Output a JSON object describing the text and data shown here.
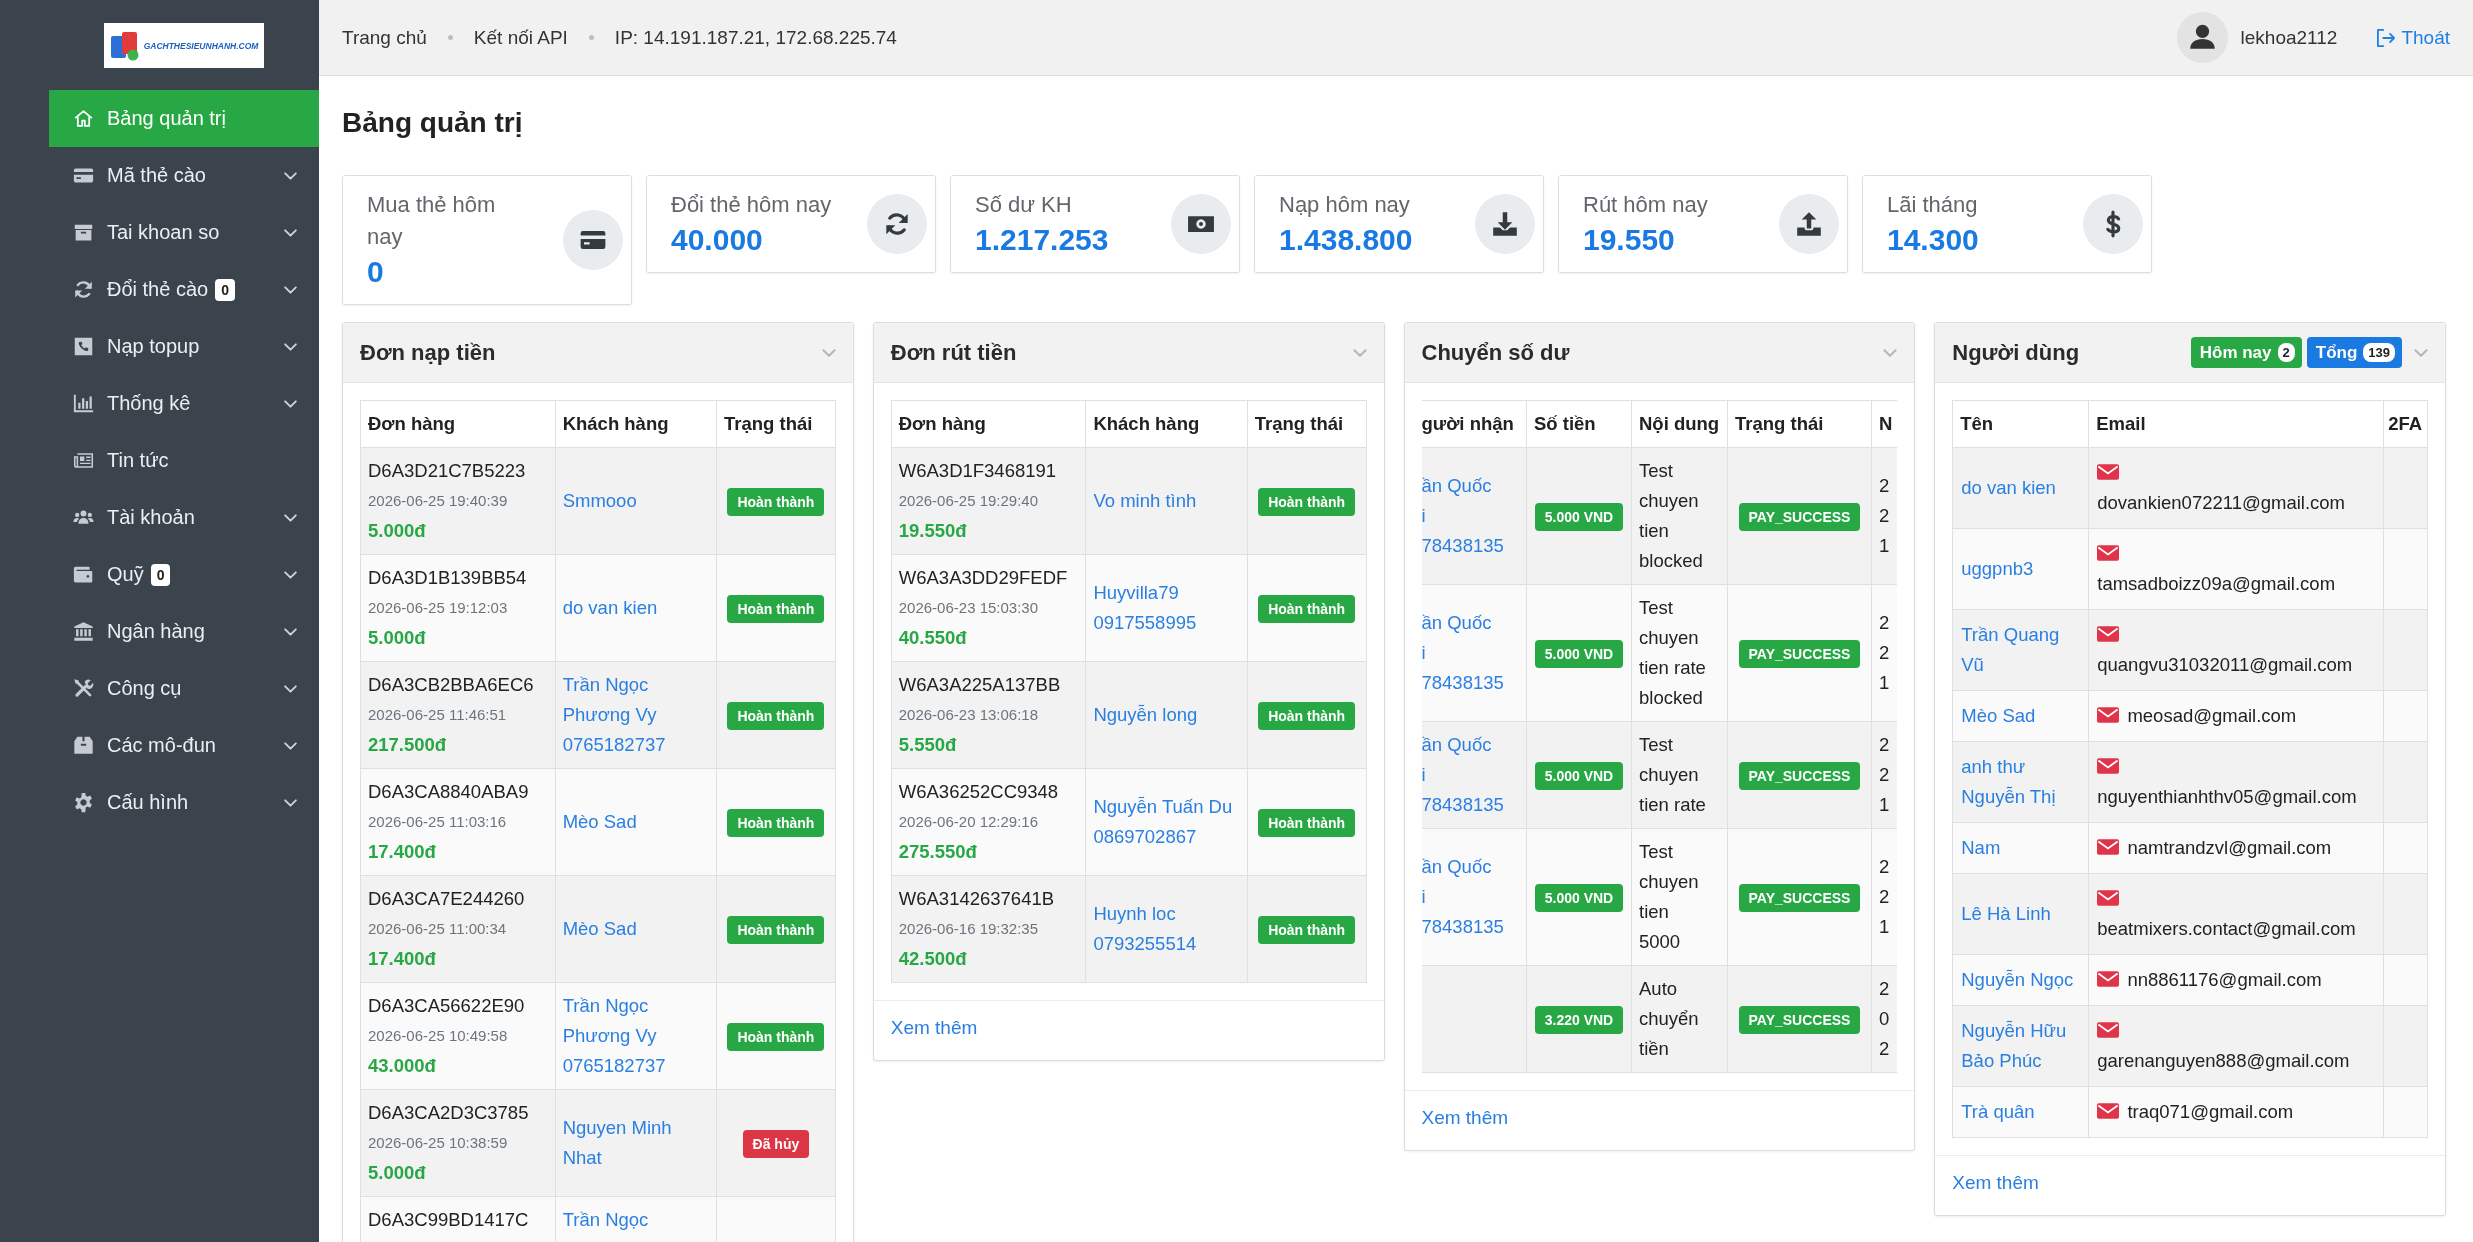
{
  "sidebar": {
    "logo": {
      "text": "GACHTHESIEUNHANH.COM"
    },
    "items": [
      {
        "label": "Bảng quản trị",
        "selected": true,
        "has_submenu": false
      },
      {
        "label": "Mã thẻ cào",
        "selected": false,
        "has_submenu": true
      },
      {
        "label": "Tai khoan so",
        "selected": false,
        "has_submenu": true
      },
      {
        "label": "Đổi thẻ cào",
        "badge": "0",
        "selected": false,
        "has_submenu": true
      },
      {
        "label": "Nạp topup",
        "selected": false,
        "has_submenu": true
      },
      {
        "label": "Thống kê",
        "selected": false,
        "has_submenu": true
      },
      {
        "label": "Tin tức",
        "selected": false,
        "has_submenu": false
      },
      {
        "label": "Tài khoản",
        "selected": false,
        "has_submenu": true
      },
      {
        "label": "Quỹ",
        "badge": "0",
        "selected": false,
        "has_submenu": true
      },
      {
        "label": "Ngân hàng",
        "selected": false,
        "has_submenu": true
      },
      {
        "label": "Công cụ",
        "selected": false,
        "has_submenu": true
      },
      {
        "label": "Các mô-đun",
        "selected": false,
        "has_submenu": true
      },
      {
        "label": "Cấu hình",
        "selected": false,
        "has_submenu": true
      }
    ]
  },
  "header": {
    "nav_links": [
      "Trang chủ",
      "Kết nối API"
    ],
    "ip_text": "IP: 14.191.187.21, 172.68.225.74",
    "username": "lekhoa2112",
    "logout": "Thoát"
  },
  "page_title": "Bảng quản trị",
  "stats": [
    {
      "label": "Mua thẻ hôm nay",
      "value": "0"
    },
    {
      "label": "Đổi thẻ hôm nay",
      "value": "40.000"
    },
    {
      "label": "Số dư KH",
      "value": "1.217.253"
    },
    {
      "label": "Nạp hôm nay",
      "value": "1.438.800"
    },
    {
      "label": "Rút hôm nay",
      "value": "19.550"
    },
    {
      "label": "Lãi tháng",
      "value": "14.300"
    }
  ],
  "panels": [
    {
      "kind": "orders",
      "title": "Đơn nạp tiền",
      "table": {
        "columns": [
          "Đơn hàng",
          "Khách hàng",
          "Trạng thái"
        ],
        "rows": [
          {
            "order_id": "D6A3D21C7B5223",
            "time": "2026-06-25 19:40:39",
            "amount": "5.000đ",
            "customer": {
              "name": "Smmooo"
            },
            "status": {
              "label": "Hoàn thành",
              "kind": "success"
            }
          },
          {
            "order_id": "D6A3D1B139BB54",
            "time": "2026-06-25 19:12:03",
            "amount": "5.000đ",
            "customer": {
              "name": "do van kien"
            },
            "status": {
              "label": "Hoàn thành",
              "kind": "success"
            }
          },
          {
            "order_id": "D6A3CB2BBA6EC6",
            "time": "2026-06-25 11:46:51",
            "amount": "217.500đ",
            "customer": {
              "name": "Trần Ngọc Phương Vy",
              "phone": "0765182737"
            },
            "status": {
              "label": "Hoàn thành",
              "kind": "success"
            }
          },
          {
            "order_id": "D6A3CA8840ABA9",
            "time": "2026-06-25 11:03:16",
            "amount": "17.400đ",
            "customer": {
              "name": "Mèo Sad"
            },
            "status": {
              "label": "Hoàn thành",
              "kind": "success"
            }
          },
          {
            "order_id": "D6A3CA7E244260",
            "time": "2026-06-25 11:00:34",
            "amount": "17.400đ",
            "customer": {
              "name": "Mèo Sad"
            },
            "status": {
              "label": "Hoàn thành",
              "kind": "success"
            }
          },
          {
            "order_id": "D6A3CA56622E90",
            "time": "2026-06-25 10:49:58",
            "amount": "43.000đ",
            "customer": {
              "name": "Trần Ngọc Phương Vy",
              "phone": "0765182737"
            },
            "status": {
              "label": "Hoàn thành",
              "kind": "success"
            }
          },
          {
            "order_id": "D6A3CA2D3C3785",
            "time": "2026-06-25 10:38:59",
            "amount": "5.000đ",
            "customer": {
              "name": "Nguyen Minh Nhat"
            },
            "status": {
              "label": "Đã hủy",
              "kind": "cancelled"
            }
          },
          {
            "order_id": "D6A3C99BD1417C",
            "customer": {
              "name": "Trần Ngọc"
            }
          }
        ]
      }
    },
    {
      "kind": "orders",
      "title": "Đơn rút tiền",
      "table": {
        "columns": [
          "Đơn hàng",
          "Khách hàng",
          "Trạng thái"
        ],
        "rows": [
          {
            "order_id": "W6A3D1F3468191",
            "time": "2026-06-25 19:29:40",
            "amount": "19.550đ",
            "customer": {
              "name": "Vo minh tình"
            },
            "status": {
              "label": "Hoàn thành",
              "kind": "success"
            }
          },
          {
            "order_id": "W6A3A3DD29FEDF",
            "time": "2026-06-23 15:03:30",
            "amount": "40.550đ",
            "customer": {
              "name": "Huyvilla79",
              "phone": "0917558995"
            },
            "status": {
              "label": "Hoàn thành",
              "kind": "success"
            }
          },
          {
            "order_id": "W6A3A225A137BB",
            "time": "2026-06-23 13:06:18",
            "amount": "5.550đ",
            "customer": {
              "name": "Nguyễn long"
            },
            "status": {
              "label": "Hoàn thành",
              "kind": "success"
            }
          },
          {
            "order_id": "W6A36252CC9348",
            "time": "2026-06-20 12:29:16",
            "amount": "275.550đ",
            "customer": {
              "name": "Nguyễn Tuấn Du",
              "phone": "0869702867"
            },
            "status": {
              "label": "Hoàn thành",
              "kind": "success"
            }
          },
          {
            "order_id": "W6A3142637641B",
            "time": "2026-06-16 19:32:35",
            "amount": "42.500đ",
            "customer": {
              "name": "Huynh loc",
              "phone": "0793255514"
            },
            "status": {
              "label": "Hoàn thành",
              "kind": "success"
            }
          }
        ]
      },
      "footer_link": "Xem thêm"
    },
    {
      "kind": "transfers",
      "title": "Chuyển số dư",
      "table": {
        "columns": [
          "gười nhận",
          "Số tiền",
          "Nội dung",
          "Trạng thái",
          "N"
        ],
        "rows": [
          {
            "recipient_lines": [
              "ần Quốc",
              "i",
              "78438135"
            ],
            "amount": "5.000 VND",
            "note": "Test chuyen tien blocked",
            "status": {
              "label": "PAY_SUCCESS",
              "kind": "success"
            },
            "column_5_lines": [
              "2",
              "2",
              "1"
            ]
          },
          {
            "recipient_lines": [
              "ần Quốc",
              "i",
              "78438135"
            ],
            "amount": "5.000 VND",
            "note": "Test chuyen tien rate blocked",
            "status": {
              "label": "PAY_SUCCESS",
              "kind": "success"
            },
            "column_5_lines": [
              "2",
              "2",
              "1"
            ]
          },
          {
            "recipient_lines": [
              "ần Quốc",
              "i",
              "78438135"
            ],
            "amount": "5.000 VND",
            "note": "Test chuyen tien rate",
            "status": {
              "label": "PAY_SUCCESS",
              "kind": "success"
            },
            "column_5_lines": [
              "2",
              "2",
              "1"
            ]
          },
          {
            "recipient_lines": [
              "ần Quốc",
              "i",
              "78438135"
            ],
            "amount": "5.000 VND",
            "note": "Test chuyen tien 5000",
            "status": {
              "label": "PAY_SUCCESS",
              "kind": "success"
            },
            "column_5_lines": [
              "2",
              "2",
              "1"
            ]
          },
          {
            "amount": "3.220 VND",
            "note": "Auto chuyển tiền",
            "status": {
              "label": "PAY_SUCCESS",
              "kind": "success"
            },
            "column_5_lines": [
              "2",
              "0",
              "2"
            ]
          }
        ]
      },
      "footer_link": "Xem thêm"
    },
    {
      "kind": "users",
      "title": "Người dùng",
      "badges": [
        {
          "label": "Hôm nay",
          "count": "2",
          "color": "#28a745"
        },
        {
          "label": "Tổng",
          "count": "139",
          "color": "#1a7ae2"
        }
      ],
      "table": {
        "columns": [
          "Tên",
          "Email",
          "2FA"
        ],
        "rows": [
          {
            "name": "do van kien",
            "email": "dovankien072211@gmail.com"
          },
          {
            "name": "uggpnb3",
            "email": "tamsadboizz09a@gmail.com"
          },
          {
            "name": "Trần Quang Vũ",
            "email": "quangvu31032011@gmail.com"
          },
          {
            "name": "Mèo Sad",
            "email": "meosad@gmail.com"
          },
          {
            "name": "anh thư Nguyễn Thị",
            "email": "nguyenthianhthv05@gmail.com"
          },
          {
            "name": "Nam",
            "email": "namtrandzvl@gmail.com"
          },
          {
            "name": "Lê Hà Linh",
            "email": "beatmixers.contact@gmail.com"
          },
          {
            "name": "Nguyễn Ngọc",
            "email": "nn8861176@gmail.com"
          },
          {
            "name": "Nguyễn Hữu Bảo Phúc",
            "email": "garenanguyen888@gmail.com"
          },
          {
            "name": "Trà quân",
            "email": "traq071@gmail.com"
          }
        ]
      },
      "footer_link": "Xem thêm"
    }
  ]
}
